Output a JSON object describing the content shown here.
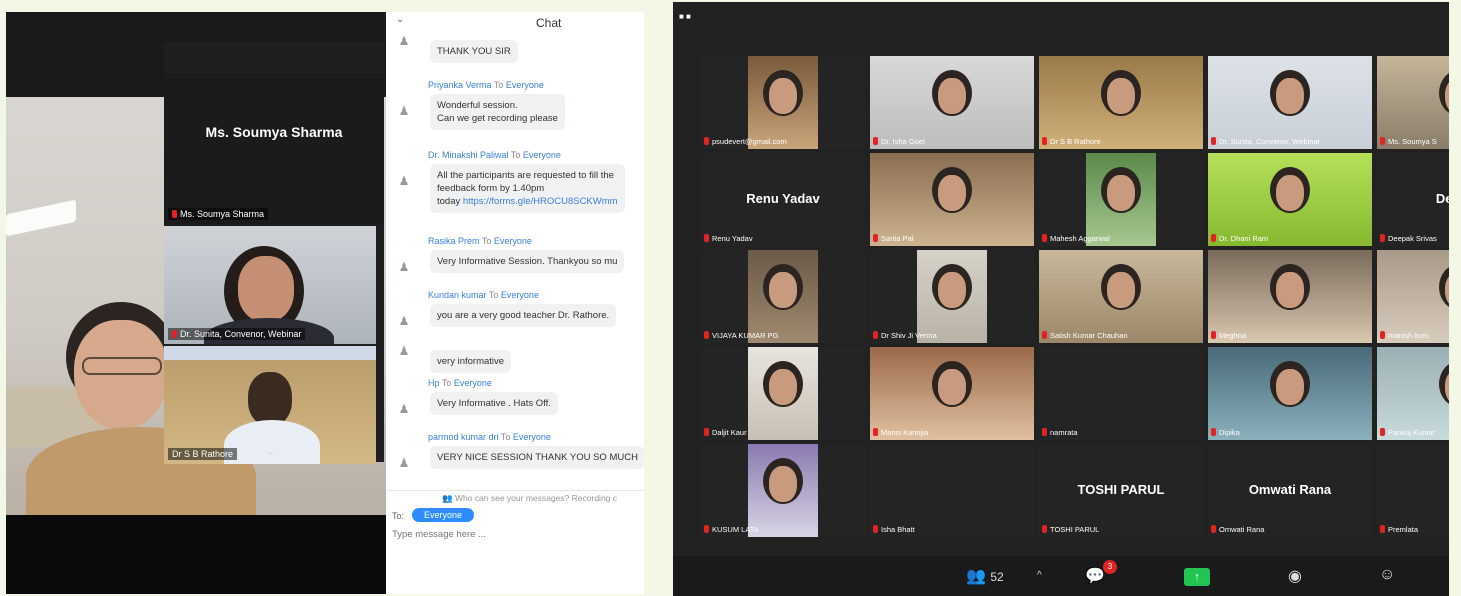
{
  "left": {
    "active_speaker_name": "Ms. Soumya Sharma",
    "side_tiles": [
      {
        "label": "Dr. Sunita, Convenor, Webinar"
      },
      {
        "label": "Dr S B Rathore"
      }
    ],
    "chevron": "chevron-down-icon"
  },
  "chat": {
    "collapse": "⌄",
    "title": "Chat",
    "messages": [
      {
        "sender": "",
        "to": "",
        "text": [
          "THANK YOU SIR"
        ]
      },
      {
        "sender": "Priyanka Verma",
        "to": "Everyone",
        "text": [
          "Wonderful session.",
          "Can we get recording please"
        ]
      },
      {
        "sender": "Dr. Minakshi Paliwal",
        "to": "Everyone",
        "text": [
          "All the participants are requested to fill the",
          "feedback form by 1.40pm"
        ],
        "link_prefix": "today ",
        "link": "https://forms.gle/HROCU8SCKWmm"
      },
      {
        "sender": "Rasika Prem",
        "to": "Everyone",
        "text": [
          "Very Informative Session. Thankyou so mu"
        ]
      },
      {
        "sender": "Kundan kumar",
        "to": "Everyone",
        "text": [
          "you are a very good teacher Dr. Rathore."
        ]
      },
      {
        "sender": "",
        "to": "",
        "text": [
          "very informative"
        ]
      },
      {
        "sender": "Hp",
        "to": "Everyone",
        "text": [
          "Very Informative . Hats Off."
        ]
      },
      {
        "sender": "parmod kumar dri",
        "to": "Everyone",
        "text": [
          "VERY NICE SESSION THANK YOU SO MUCH"
        ]
      }
    ],
    "to_word": "To",
    "who_can_see": "Who can see your messages? Recording c",
    "to_label": "To:",
    "to_value": "Everyone",
    "input_placeholder": "Type message here ..."
  },
  "grid": {
    "tiles": [
      {
        "label": "psudevert@gmail.com",
        "name": "",
        "video": true
      },
      {
        "label": "Dr. Isha Goel",
        "name": "",
        "video": true
      },
      {
        "label": "Dr S B Rathore",
        "name": "",
        "video": true
      },
      {
        "label": "Dr. Sunita, Convenor, Webinar",
        "name": "",
        "video": true
      },
      {
        "label": "Ms. Soumya S",
        "name": "",
        "video": true,
        "active": true
      },
      {
        "label": "Renu Yadav",
        "name": "Renu Yadav",
        "video": false
      },
      {
        "label": "Sarita Pal",
        "name": "",
        "video": true
      },
      {
        "label": "Mahesh Aggarwal",
        "name": "",
        "video": true
      },
      {
        "label": "Dr. Dhani Ram",
        "name": "",
        "video": true
      },
      {
        "label": "Deepak Srivas",
        "name": "Deepak",
        "video": false
      },
      {
        "label": "VIJAYA KUMAR PG",
        "name": "",
        "video": true
      },
      {
        "label": "Dr Shiv Ji Verma",
        "name": "",
        "video": true
      },
      {
        "label": "Satish Kumar Chauhan",
        "name": "",
        "video": true
      },
      {
        "label": "Meghna",
        "name": "",
        "video": true
      },
      {
        "label": "manish kum",
        "name": "",
        "video": true
      },
      {
        "label": "Daljit Kaur",
        "name": "",
        "video": true
      },
      {
        "label": "Mansi Kanojia",
        "name": "",
        "video": true
      },
      {
        "label": "namrata",
        "name": "",
        "video": false
      },
      {
        "label": "Dipika",
        "name": "",
        "video": true
      },
      {
        "label": "Pankaj Kumar",
        "name": "",
        "video": true
      },
      {
        "label": "KUSUM LATA",
        "name": "",
        "video": true
      },
      {
        "label": "Isha Bhatt",
        "name": "",
        "video": false
      },
      {
        "label": "TOSHI PARUL",
        "name": "TOSHI PARUL",
        "video": false
      },
      {
        "label": "Omwati Rana",
        "name": "Omwati Rana",
        "video": false
      },
      {
        "label": "Premlata",
        "name": "Pre",
        "video": false
      }
    ]
  },
  "toolbar": {
    "participants_count": "52",
    "chat_badge": "3",
    "share_icon": "arrow-up-icon"
  },
  "colors": {
    "accent": "#2d8cff",
    "mic_muted": "#e02424",
    "share_green": "#23c552",
    "active_outline": "#e8e06a"
  }
}
